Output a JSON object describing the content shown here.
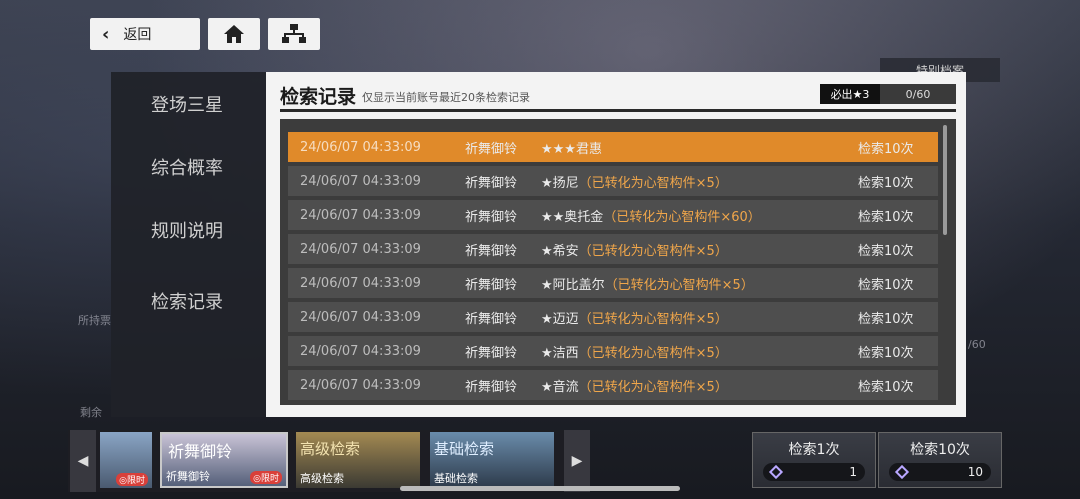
{
  "topbar": {
    "back_label": "返回"
  },
  "archive_label": "特别档案",
  "sidebar": {
    "items": [
      {
        "label": "登场三星"
      },
      {
        "label": "综合概率"
      },
      {
        "label": "规则说明"
      },
      {
        "label": "检索记录"
      }
    ],
    "active_index": 3
  },
  "panel": {
    "title": "检索记录",
    "subtitle": "仅显示当前账号最近20条检索记录",
    "guarantee_label": "必出★3",
    "guarantee_value": "0/60"
  },
  "records": [
    {
      "time": "24/06/07 04:33:09",
      "pool": "祈舞御铃",
      "result": "★★★君惠",
      "converted": "",
      "count": "检索10次"
    },
    {
      "time": "24/06/07 04:33:09",
      "pool": "祈舞御铃",
      "result": "★扬尼",
      "converted": "（已转化为心智构件×5）",
      "count": "检索10次"
    },
    {
      "time": "24/06/07 04:33:09",
      "pool": "祈舞御铃",
      "result": "★★奥托金",
      "converted": "（已转化为心智构件×60）",
      "count": "检索10次"
    },
    {
      "time": "24/06/07 04:33:09",
      "pool": "祈舞御铃",
      "result": "★希安",
      "converted": "（已转化为心智构件×5）",
      "count": "检索10次"
    },
    {
      "time": "24/06/07 04:33:09",
      "pool": "祈舞御铃",
      "result": "★阿比盖尔",
      "converted": "（已转化为心智构件×5）",
      "count": "检索10次"
    },
    {
      "time": "24/06/07 04:33:09",
      "pool": "祈舞御铃",
      "result": "★迈迈",
      "converted": "（已转化为心智构件×5）",
      "count": "检索10次"
    },
    {
      "time": "24/06/07 04:33:09",
      "pool": "祈舞御铃",
      "result": "★洁西",
      "converted": "（已转化为心智构件×5）",
      "count": "检索10次"
    },
    {
      "time": "24/06/07 04:33:09",
      "pool": "祈舞御铃",
      "result": "★音流",
      "converted": "（已转化为心智构件×5）",
      "count": "检索10次"
    }
  ],
  "banners": [
    {
      "title": "",
      "caption": "",
      "badge": "◎限时"
    },
    {
      "title": "祈舞御铃",
      "caption": "祈舞御铃",
      "badge": "◎限时"
    },
    {
      "title": "高级检索",
      "caption": "高级检索",
      "badge": ""
    },
    {
      "title": "基础检索",
      "caption": "基础检索",
      "badge": ""
    }
  ],
  "pulls": [
    {
      "label": "检索1次",
      "cost": "1"
    },
    {
      "label": "检索10次",
      "cost": "10"
    }
  ],
  "background_text": {
    "pool_tag": "所持票",
    "remaining": "剩余",
    "side_count": "/60"
  },
  "colors": {
    "highlight_row": "#e08a2a",
    "converted_text": "#f0a64a"
  }
}
